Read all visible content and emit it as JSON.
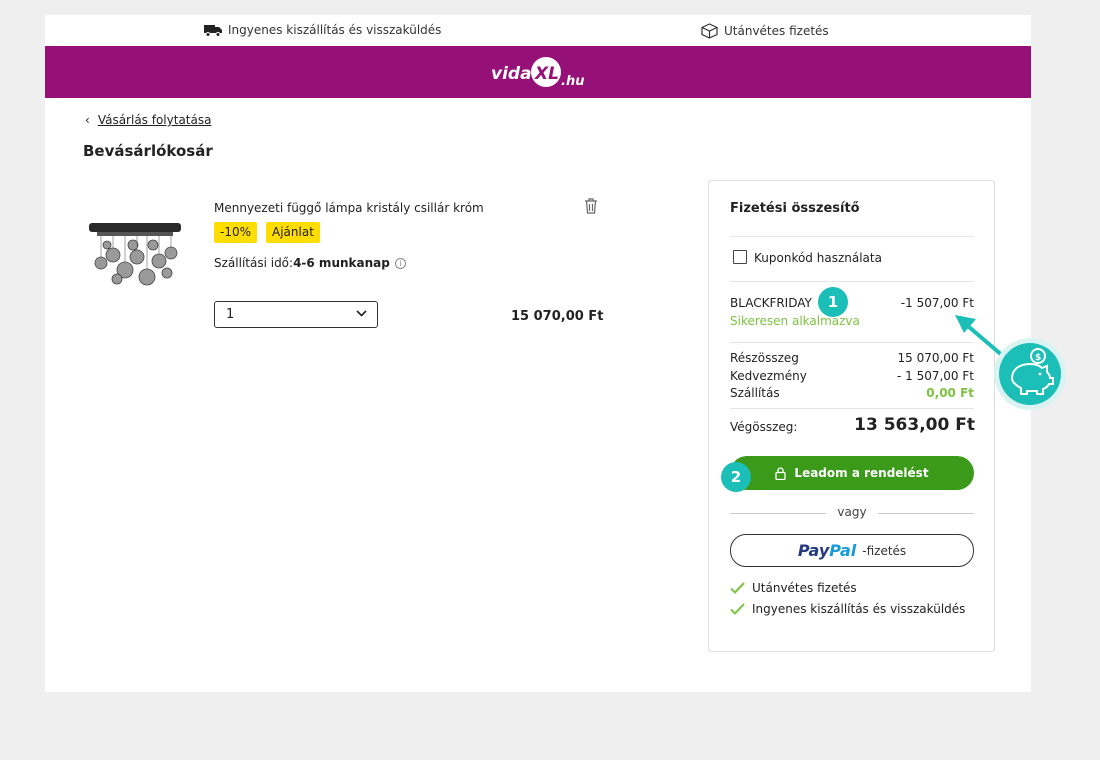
{
  "topbar": {
    "shipping_text": "Ingyenes kiszállítás és visszaküldés",
    "cod_text": "Utánvétes fizetés",
    "truck_icon": "truck-icon",
    "box_icon": "box-icon"
  },
  "header": {
    "brand_color": "#951178",
    "logo_text_left": "vida",
    "logo_text_mid": "XL",
    "logo_text_right": ".hu"
  },
  "nav": {
    "back_arrow": "‹",
    "back_link": "Vásárlás folytatása"
  },
  "cart": {
    "title": "Bevásárlókosár",
    "item": {
      "name": "Mennyezeti függő lámpa kristály csillár króm",
      "badge_discount": "-10%",
      "badge_offer": "Ajánlat",
      "shipping_label": "Szállítási idő:",
      "shipping_value": "4-6 munkanap",
      "quantity": "1",
      "price": "15 070,00 Ft"
    }
  },
  "summary": {
    "title": "Fizetési összesítő",
    "coupon_label": "Kuponkód használata",
    "coupon_code": "BLACKFRIDAY",
    "coupon_amount": "-1 507,00 Ft",
    "coupon_status": "Sikeresen alkalmazva",
    "subtotal_label": "Részösszeg",
    "subtotal_value": "15 070,00 Ft",
    "discount_label": "Kedvezmény",
    "discount_value": "- 1 507,00 Ft",
    "shipping_label": "Szállítás",
    "shipping_value": "0,00 Ft",
    "total_label": "Végösszeg:",
    "total_value": "13 563,00 Ft",
    "order_button": "Leadom a rendelést",
    "or_text": "vagy",
    "paypal_pay": "Pay",
    "paypal_pal": "Pal",
    "paypal_suffix": "-fizetés",
    "benefits": [
      "Utánvétes fizetés",
      "Ingyenes kiszállítás és visszaküldés"
    ]
  },
  "annotations": {
    "step1": "1",
    "step2": "2",
    "accent_color": "#1bbfb8"
  }
}
